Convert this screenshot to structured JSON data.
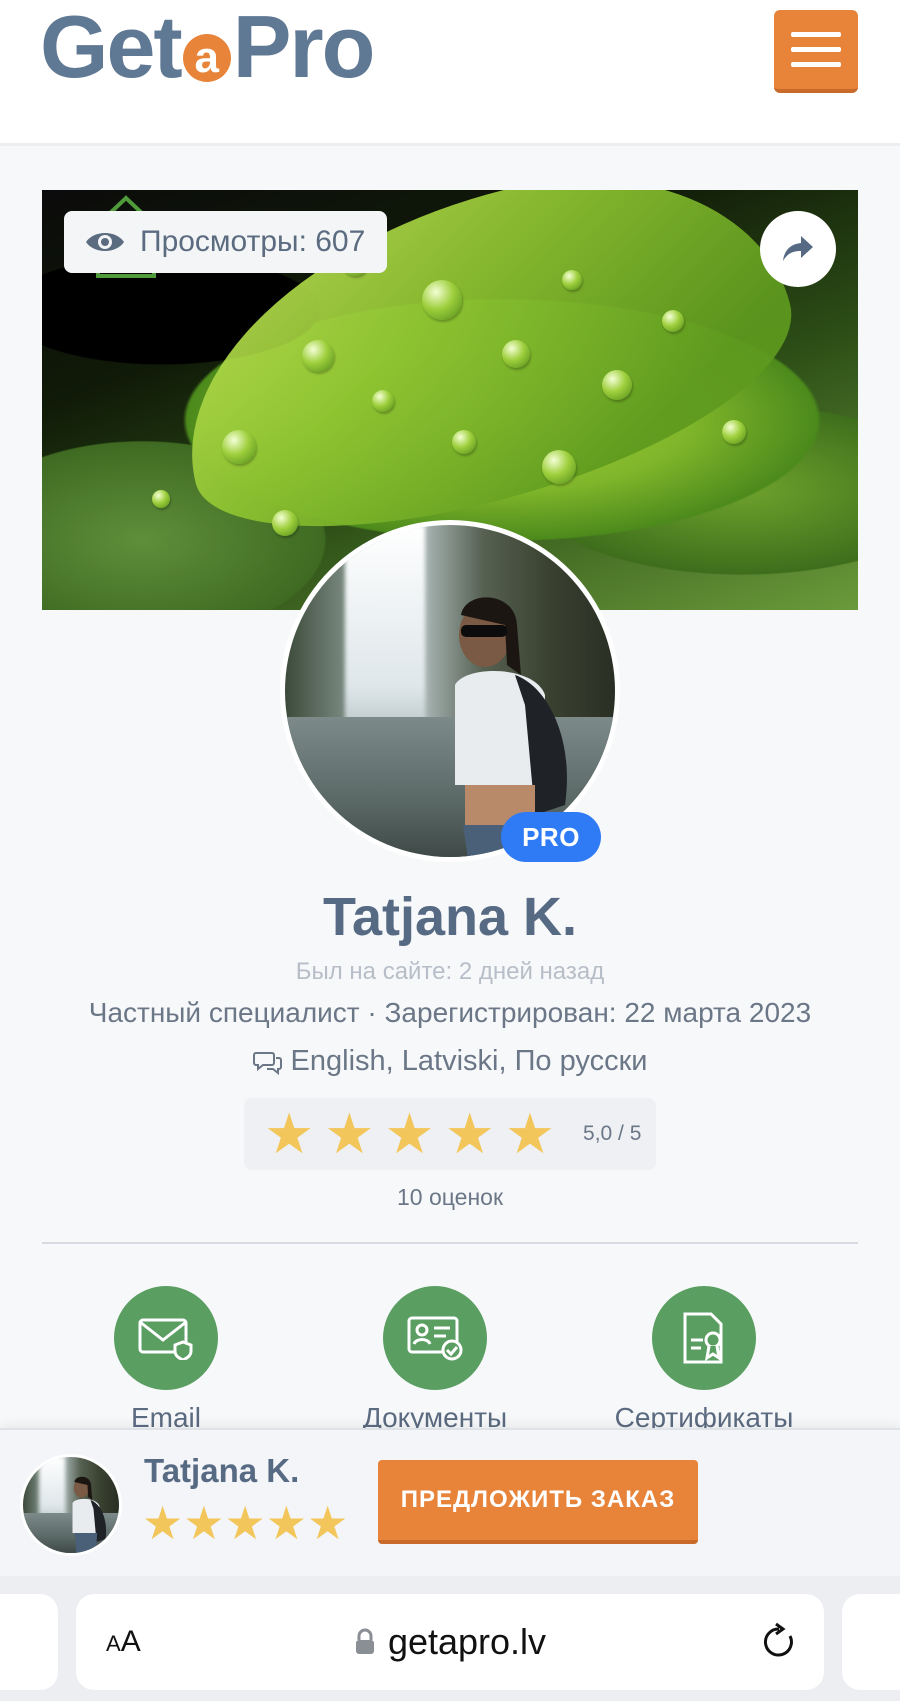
{
  "header": {
    "logo": {
      "part1": "Get",
      "part2": "a",
      "part3": "Pro"
    },
    "menu_icon": "hamburger-icon",
    "accent_color": "#e8843a"
  },
  "cover": {
    "views_label": "Просмотры: 607",
    "views_icon": "eye-icon",
    "share_icon": "share-arrow-icon"
  },
  "profile": {
    "badge": "PRO",
    "name": "Tatjana K.",
    "last_seen": "Был на сайте: 2 дней назад",
    "meta": "Частный специалист · Зарегистрирован: 22 марта 2023",
    "languages": "English, Latviski, По русски",
    "rating": {
      "stars": 5,
      "value_label": "5,0 / 5",
      "count_label": "10 оценок"
    },
    "star_color": "#f2c65a",
    "badge_color": "#2f7bf5"
  },
  "features": [
    {
      "label": "Email",
      "icon": "envelope-shield-icon"
    },
    {
      "label": "Документы",
      "icon": "id-card-check-icon"
    },
    {
      "label": "Сертификаты",
      "icon": "certificate-icon"
    }
  ],
  "sticky": {
    "name": "Tatjana K.",
    "order_button": "ПРЕДЛОЖИТЬ ЗАКАЗ"
  },
  "browser": {
    "text_size_label": "AA",
    "url": "getapro.lv"
  }
}
